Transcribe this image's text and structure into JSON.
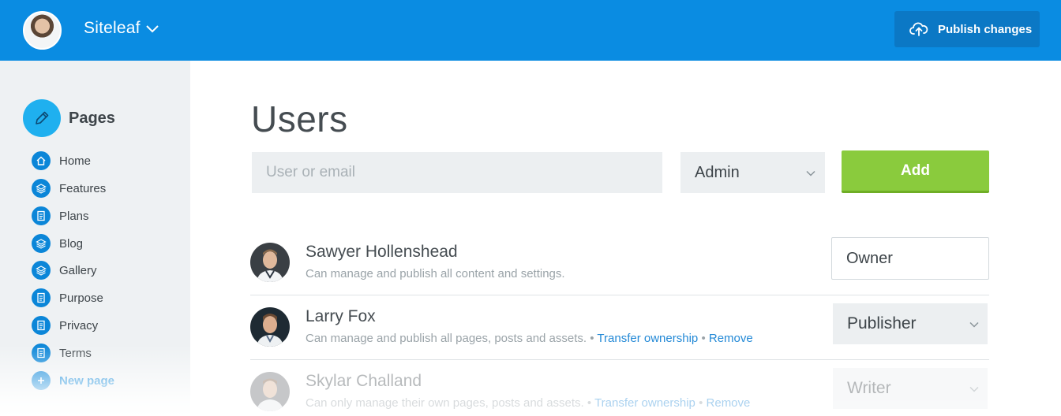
{
  "header": {
    "site_name": "Siteleaf",
    "publish_label": "Publish changes",
    "avatar_icon": "user-avatar",
    "chevron_icon": "chevron-down-icon",
    "cloud_icon": "cloud-upload-icon"
  },
  "sidebar": {
    "section_title": "Pages",
    "section_icon": "pencil-icon",
    "items": [
      {
        "label": "Home",
        "icon": "home-icon"
      },
      {
        "label": "Features",
        "icon": "layers-icon"
      },
      {
        "label": "Plans",
        "icon": "page-icon"
      },
      {
        "label": "Blog",
        "icon": "layers-icon"
      },
      {
        "label": "Gallery",
        "icon": "layers-icon"
      },
      {
        "label": "Purpose",
        "icon": "page-icon"
      },
      {
        "label": "Privacy",
        "icon": "page-icon"
      },
      {
        "label": "Terms",
        "icon": "page-icon"
      },
      {
        "label": "New page",
        "icon": "plus-icon"
      }
    ]
  },
  "main": {
    "title": "Users",
    "search_placeholder": "User or email",
    "role_default": "Admin",
    "add_label": "Add",
    "users": [
      {
        "name": "Sawyer Hollenshead",
        "description": "Can manage and publish all content and settings.",
        "role": "Owner"
      },
      {
        "name": "Larry Fox",
        "description": "Can manage and publish all pages, posts and assets.",
        "transfer_label": "Transfer ownership",
        "remove_label": "Remove",
        "separator": "•",
        "role": "Publisher"
      },
      {
        "name": "Skylar Challand",
        "description": "Can only manage their own pages, posts and assets.",
        "transfer_label": "Transfer ownership",
        "remove_label": "Remove",
        "separator": "•",
        "role": "Writer"
      }
    ]
  },
  "colors": {
    "topbar": "#0a8ce2",
    "accent_green": "#8acb3d",
    "link_blue": "#2389d6",
    "sidebar_bg": "#eef1f3"
  }
}
